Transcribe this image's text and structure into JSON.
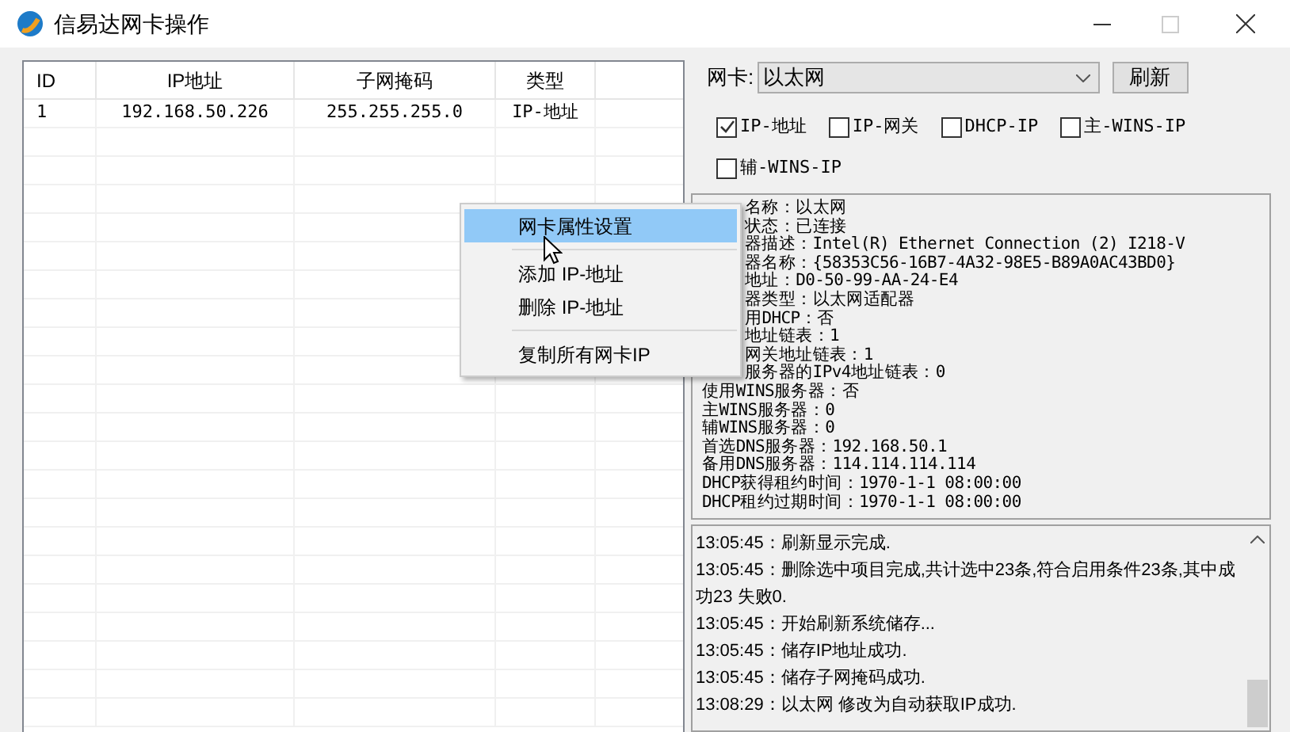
{
  "window": {
    "title": "信易达网卡操作"
  },
  "table": {
    "columns": [
      "ID",
      "IP地址",
      "子网掩码",
      "类型"
    ],
    "rows": [
      [
        "1",
        "192.168.50.226",
        "255.255.255.0",
        "IP-地址"
      ]
    ]
  },
  "adapter": {
    "label": "网卡:",
    "value": "以太网",
    "refresh": "刷新"
  },
  "checkboxes": [
    {
      "label": "IP-地址",
      "checked": true
    },
    {
      "label": "IP-网关",
      "checked": false
    },
    {
      "label": "DHCP-IP",
      "checked": false
    },
    {
      "label": "主-WINS-IP",
      "checked": false
    },
    {
      "label": "辅-WINS-IP",
      "checked": false
    }
  ],
  "info_lines_behind_menu": [
    "名称：以太网",
    "状态：已连接",
    "器描述：Intel(R) Ethernet Connection (2) I218-V",
    "器名称：{58353C56-16B7-4A32-98E5-B89A0AC43BD0}",
    "地址：D0-50-99-AA-24-E4",
    "器类型：以太网适配器",
    "用DHCP：否",
    "地址链表：1",
    "网关地址链表：1",
    "服务器的IPv4地址链表：0"
  ],
  "info_lines": [
    "使用WINS服务器：否",
    "主WINS服务器：0",
    "辅WINS服务器：0",
    "首选DNS服务器：192.168.50.1",
    "备用DNS服务器：114.114.114.114",
    "DHCP获得租约时间：1970-1-1 08:00:00",
    "DHCP租约过期时间：1970-1-1 08:00:00"
  ],
  "context_menu": [
    {
      "kind": "item",
      "label": "网卡属性设置",
      "selected": true
    },
    {
      "kind": "separator"
    },
    {
      "kind": "item",
      "label": "添加 IP-地址",
      "selected": false
    },
    {
      "kind": "item",
      "label": "删除 IP-地址",
      "selected": false
    },
    {
      "kind": "separator"
    },
    {
      "kind": "item",
      "label": "复制所有网卡IP",
      "selected": false
    }
  ],
  "log": [
    "13:05:45：刷新显示完成.",
    "13:05:45：删除选中项目完成,共计选中23条,符合启用条件23条,其中成功23 失败0.",
    "13:05:45：开始刷新系统储存...",
    "13:05:45：储存IP地址成功.",
    "13:05:45：储存子网掩码成功.",
    "13:08:29：以太网 修改为自动获取IP成功."
  ]
}
